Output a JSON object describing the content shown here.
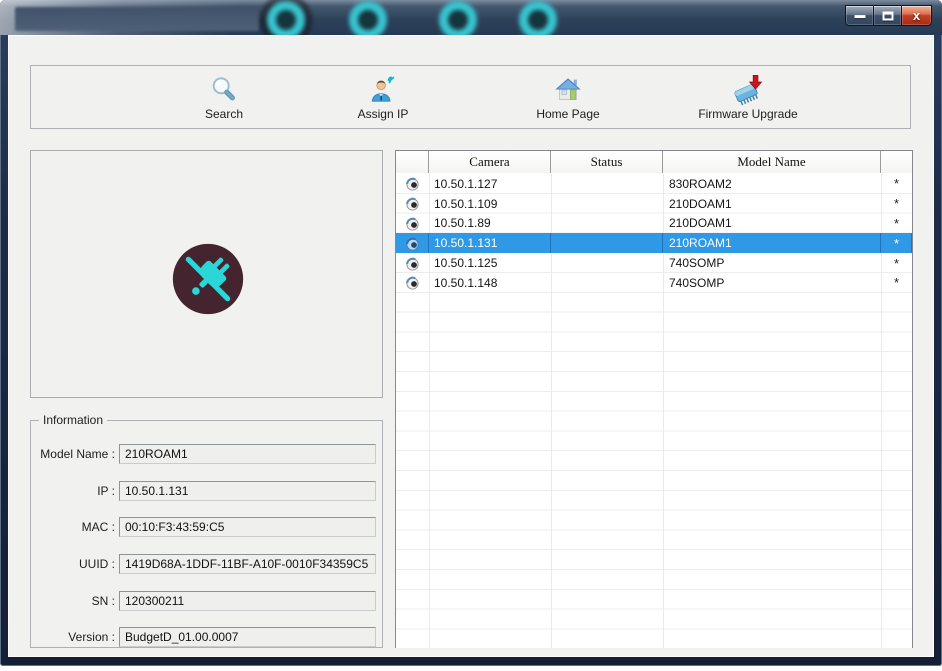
{
  "window": {
    "title_redacted": true,
    "caption_buttons": {
      "minimize": "minimize",
      "maximize": "maximize",
      "close": "close"
    },
    "close_glyph": "x"
  },
  "toolbar": {
    "buttons": [
      {
        "label": "Search",
        "icon": "magnifier-icon"
      },
      {
        "label": "Assign IP",
        "icon": "person-wifi-icon"
      },
      {
        "label": "Home Page",
        "icon": "house-icon"
      },
      {
        "label": "Firmware Upgrade",
        "icon": "chip-download-icon"
      }
    ]
  },
  "preview": {
    "status_icon": "disconnected-plug-icon"
  },
  "device_table": {
    "columns": {
      "icon": "",
      "camera": "Camera",
      "status": "Status",
      "model": "Model Name",
      "flag": ""
    },
    "rows": [
      {
        "camera": "10.50.1.127",
        "status": "",
        "model": "830ROAM2",
        "flag": "*",
        "selected": false
      },
      {
        "camera": "10.50.1.109",
        "status": "",
        "model": "210DOAM1",
        "flag": "*",
        "selected": false
      },
      {
        "camera": "10.50.1.89",
        "status": "",
        "model": "210DOAM1",
        "flag": "*",
        "selected": false
      },
      {
        "camera": "10.50.1.131",
        "status": "",
        "model": "210ROAM1",
        "flag": "*",
        "selected": true
      },
      {
        "camera": "10.50.1.125",
        "status": "",
        "model": "740SOMP",
        "flag": "*",
        "selected": false
      },
      {
        "camera": "10.50.1.148",
        "status": "",
        "model": "740SOMP",
        "flag": "*",
        "selected": false
      }
    ]
  },
  "information": {
    "title": "Information",
    "fields": [
      {
        "label": "Model Name :",
        "value": "210ROAM1"
      },
      {
        "label": "IP :",
        "value": "10.50.1.131"
      },
      {
        "label": "MAC :",
        "value": "00:10:F3:43:59:C5"
      },
      {
        "label": "UUID :",
        "value": "1419D68A-1DDF-11BF-A10F-0010F34359C5"
      },
      {
        "label": "SN :",
        "value": "120300211"
      },
      {
        "label": "Version :",
        "value": "BudgetD_01.00.0007"
      }
    ]
  },
  "colors": {
    "selection_blue": "#2f99e6",
    "titlebar_blue": "#2d4159",
    "close_button_red": "#c23f26",
    "watermark_teal": "#38c4cf",
    "plug_circle_bg": "#44242e",
    "plug_icon_teal": "#2bd6d6"
  }
}
